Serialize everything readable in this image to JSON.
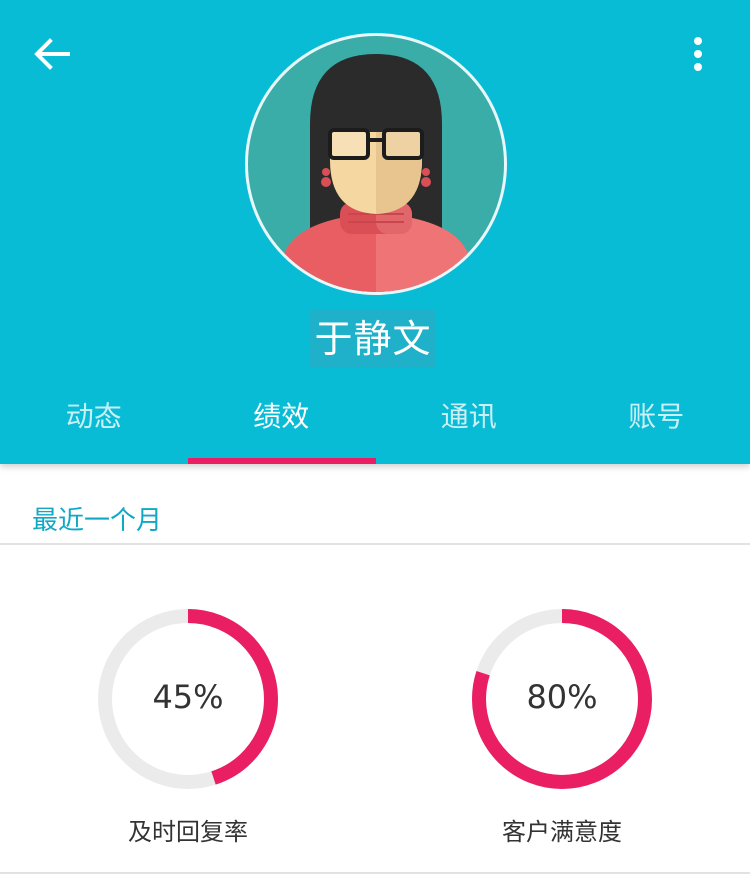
{
  "profile": {
    "name": "于静文",
    "header_color": "#08bcd6"
  },
  "tabs": [
    {
      "label": "动态",
      "active": false
    },
    {
      "label": "绩效",
      "active": true
    },
    {
      "label": "通讯",
      "active": false
    },
    {
      "label": "账号",
      "active": false
    }
  ],
  "section": {
    "title": "最近一个月"
  },
  "metrics": [
    {
      "label": "及时回复率",
      "value_text": "45%",
      "progress": 0.45
    },
    {
      "label": "客户满意度",
      "value_text": "80%",
      "progress": 0.8
    }
  ],
  "colors": {
    "accent": "#e91e63",
    "ring_track": "#ebebeb",
    "section_title": "#10a8c6"
  },
  "icons": {
    "back": "arrow-left-icon",
    "more": "more-vertical-icon"
  }
}
